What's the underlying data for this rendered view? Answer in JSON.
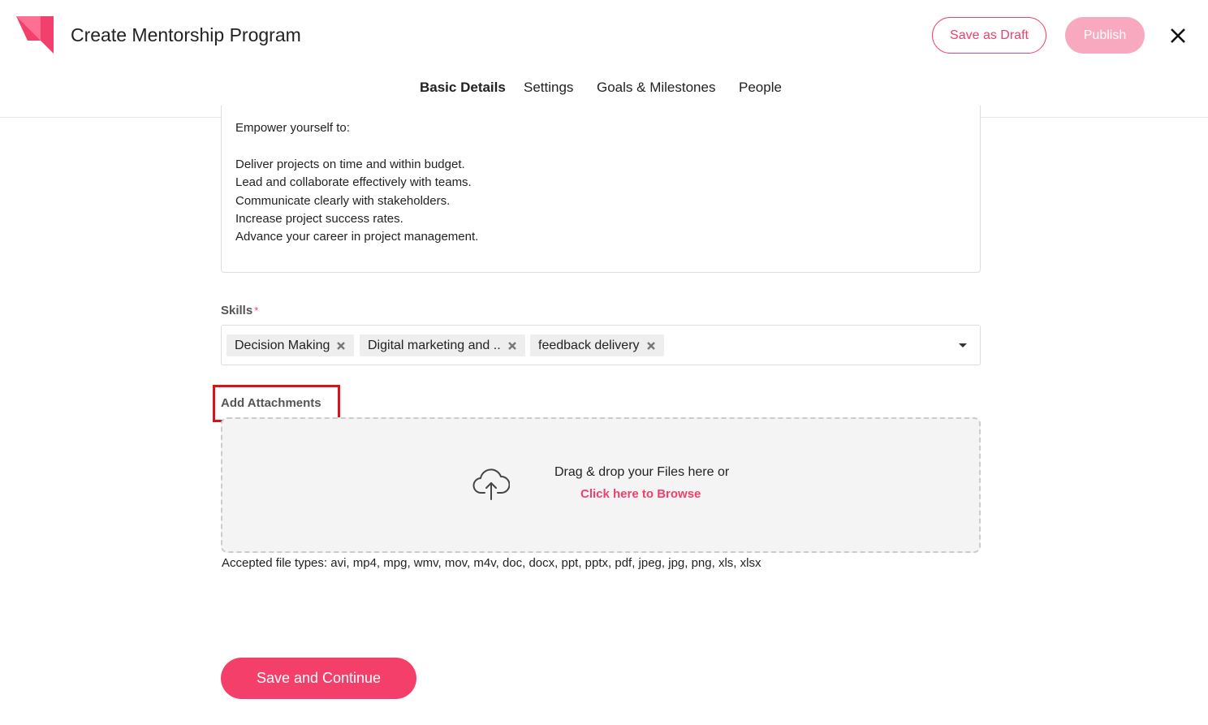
{
  "header": {
    "title": "Create Mentorship Program",
    "save_draft_label": "Save as Draft",
    "publish_label": "Publish",
    "brand_color": "#f0406b"
  },
  "tabs": [
    {
      "label": "Basic Details",
      "active": true
    },
    {
      "label": "Settings",
      "active": false
    },
    {
      "label": "Goals & Milestones",
      "active": false
    },
    {
      "label": "People",
      "active": false
    }
  ],
  "description": {
    "lines": [
      "Empower yourself to:",
      "Deliver projects on time and within budget.",
      "Lead and collaborate effectively with teams.",
      "Communicate clearly with stakeholders.",
      "Increase project success rates.",
      "Advance your career in project management."
    ]
  },
  "skills": {
    "label": "Skills",
    "required_mark": "*",
    "chips": [
      "Decision Making",
      "Digital marketing and ..",
      "feedback delivery"
    ]
  },
  "attachments": {
    "label": "Add Attachments",
    "drop_text": "Drag & drop your Files here or",
    "browse_text": "Click here to Browse",
    "accepted_text": "Accepted file types: avi, mp4, mpg, wmv, mov, m4v, doc, docx, ppt, pptx, pdf, jpeg, jpg, png, xls, xlsx"
  },
  "footer": {
    "save_continue_label": "Save and Continue"
  }
}
